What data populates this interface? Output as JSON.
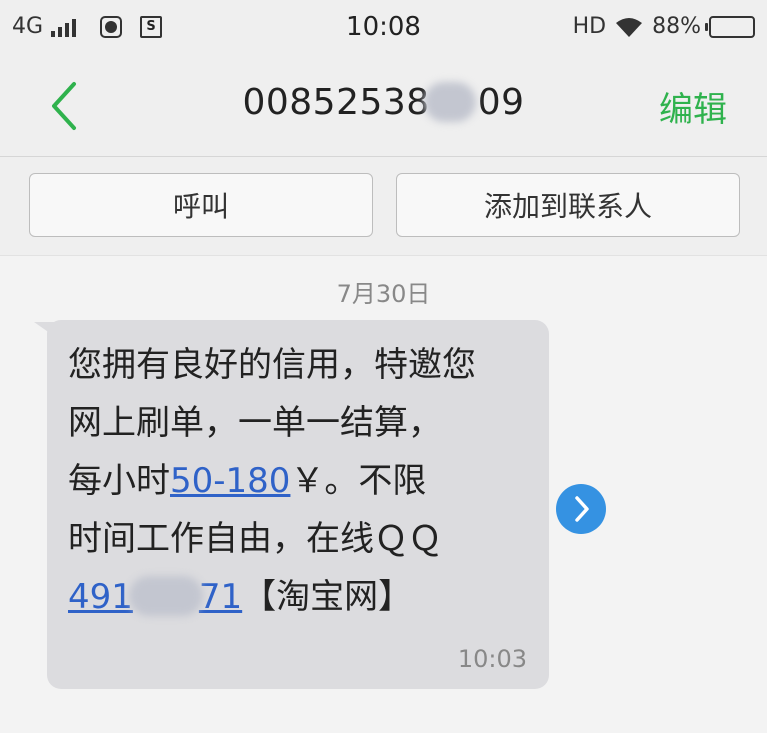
{
  "status_bar": {
    "network": "4G",
    "time": "10:08",
    "hd": "HD",
    "battery_percent": "88%",
    "battery_level": 0.88,
    "icons": [
      "signal-icon",
      "globe-icon",
      "sim-icon",
      "wifi-icon",
      "battery-icon"
    ]
  },
  "header": {
    "title_prefix": "00852538",
    "title_suffix": "09",
    "edit_label": "编辑",
    "accent_color": "#2fb24d"
  },
  "actions": {
    "call_label": "呼叫",
    "add_contact_label": "添加到联系人"
  },
  "conversation": {
    "date": "7月30日",
    "message": {
      "line1": "您拥有良好的信用，特邀您",
      "line2": "网上刷单，一单一结算，",
      "line3_prefix": "每小时",
      "line3_link": "50-180",
      "line3_suffix": "￥。不限",
      "line4": "时间工作自由，在线ＱＱ",
      "line5_link_prefix": "491",
      "line5_link_suffix": "71",
      "line5_suffix": "【淘宝网】",
      "time": "10:03",
      "link_color": "#2f62c8"
    }
  }
}
